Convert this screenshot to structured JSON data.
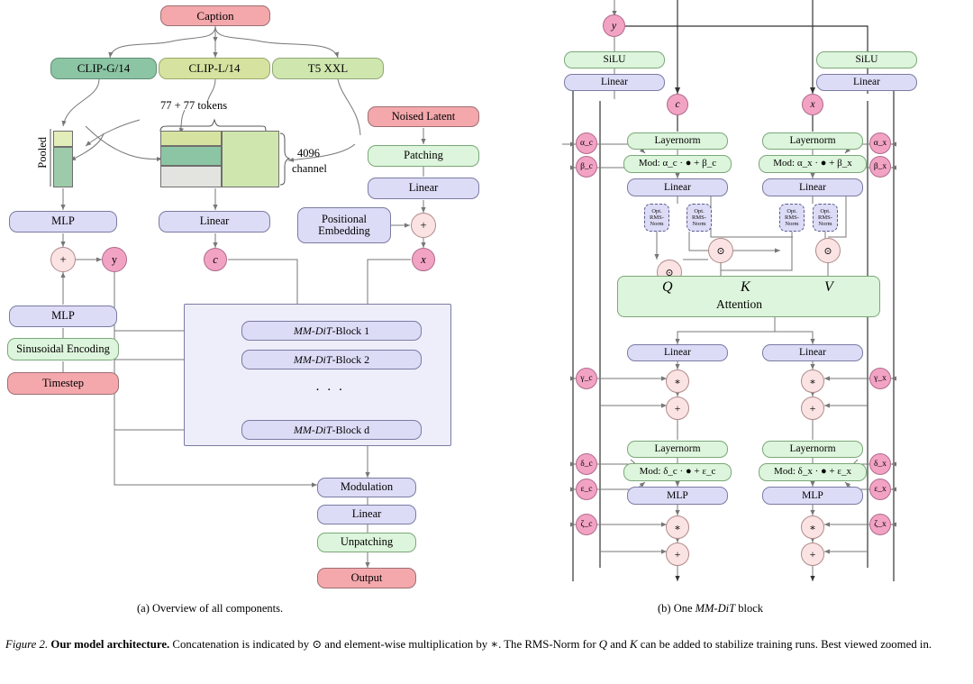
{
  "figure": {
    "subcaption_a": "(a) Overview of all components.",
    "subcaption_b_pre": "(b) One ",
    "subcaption_b_it": "MM-DiT",
    "subcaption_b_post": " block",
    "caption_label": "Figure 2.",
    "caption_bold": "Our model architecture.",
    "caption_text_1": " Concatenation is indicated by ⊙ and element-wise multiplication by ∗. The RMS-Norm for ",
    "caption_q": "Q",
    "caption_and": " and ",
    "caption_k": "K",
    "caption_text_2": "can be added to stabilize training runs. Best viewed zoomed in."
  },
  "panel_a": {
    "caption": "Caption",
    "encoders": [
      {
        "label": "CLIP-G/14",
        "color": "#8cc5a4"
      },
      {
        "label": "CLIP-L/14",
        "color": "#d6e3a0"
      },
      {
        "label": "T5 XXL",
        "color": "#cfe6ae"
      }
    ],
    "tokens_annotation": "77 + 77 tokens",
    "channel_annotation_l1": "4096",
    "channel_annotation_l2": "channel",
    "pooled_label": "Pooled",
    "noised_latent": "Noised Latent",
    "patching": "Patching",
    "linear_latent": "Linear",
    "positional_embedding_l1": "Positional",
    "positional_embedding_l2": "Embedding",
    "mlp_top": "MLP",
    "mlp_bottom": "MLP",
    "linear_context": "Linear",
    "sinusoidal": "Sinusoidal Encoding",
    "timestep": "Timestep",
    "plus_symbol": "+",
    "sym_y": "y",
    "sym_c": "c",
    "sym_x": "x",
    "blocks": [
      {
        "prefix": "MM-DiT",
        "suffix": "-Block 1"
      },
      {
        "prefix": "MM-DiT",
        "suffix": "-Block 2"
      },
      {
        "prefix": "MM-DiT",
        "suffix": "-Block d"
      }
    ],
    "ellipsis": "· · ·",
    "modulation": "Modulation",
    "linear_out": "Linear",
    "unpatching": "Unpatching",
    "output": "Output"
  },
  "panel_b": {
    "sym_y": "y",
    "sym_c": "c",
    "sym_x": "x",
    "silu": "SiLU",
    "linear": "Linear",
    "layernorm": "Layernorm",
    "mlp": "MLP",
    "attention": "Attention",
    "q": "Q",
    "k": "K",
    "v": "V",
    "rmsnorm_l1": "Opt.",
    "rmsnorm_l2": "RMS-",
    "rmsnorm_l3": "Norm",
    "mod_c_1": "Mod: α_c · ● + β_c",
    "mod_x_1": "Mod: α_x · ● + β_x",
    "mod_c_2": "Mod: δ_c · ● + ε_c",
    "mod_x_2": "Mod: δ_x · ● + ε_x",
    "concat_symbol": "⊙",
    "mult_symbol": "∗",
    "plus_symbol": "+",
    "params_c": [
      "α_c",
      "β_c",
      "γ_c",
      "δ_c",
      "ε_c",
      "ζ_c"
    ],
    "params_x": [
      "α_x",
      "β_x",
      "γ_x",
      "δ_x",
      "ε_x",
      "ζ_x"
    ]
  },
  "colors": {
    "red": "#f4a8ac",
    "blue": "#dcdcf7",
    "green": "#ddf5dc",
    "pink": "#f2a3c4",
    "op": "#fbe3e3",
    "panel": "#eeeefb",
    "line": "#6b6b6b"
  }
}
